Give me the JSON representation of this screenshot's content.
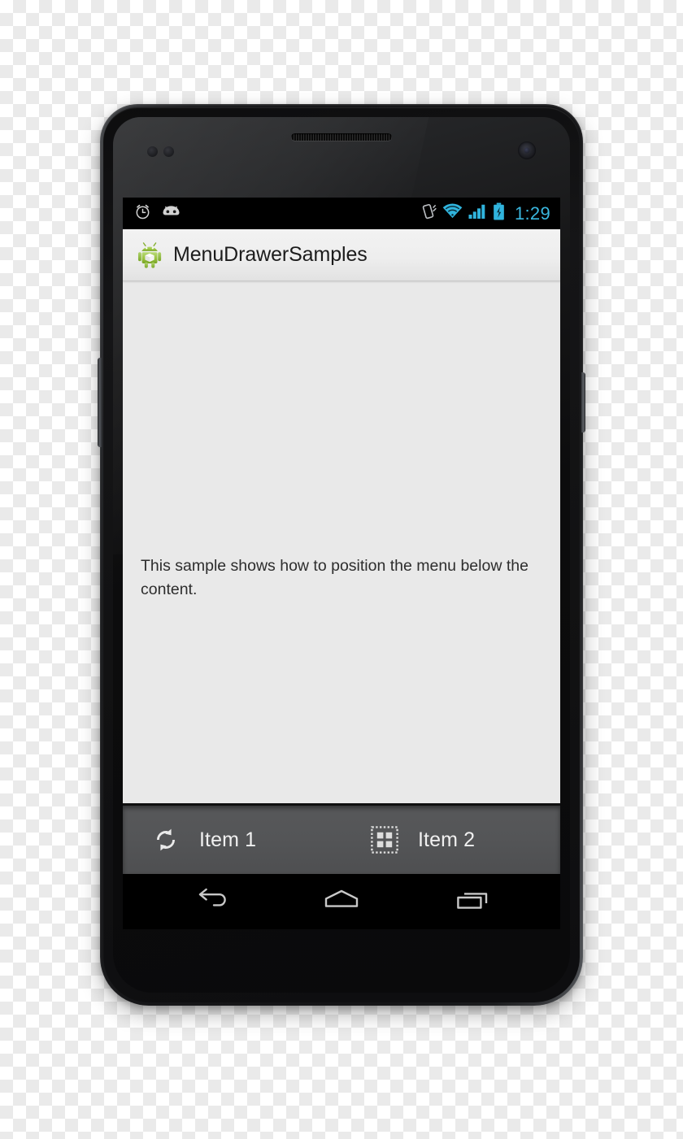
{
  "device": {
    "name": "android-phone",
    "hardware": {
      "earpiece": "earpiece-speaker",
      "front_camera": "front-camera",
      "proximity_sensor": "proximity-sensor",
      "light_sensor": "light-sensor",
      "power_button": "power-button",
      "volume_button": "volume-button"
    }
  },
  "status_bar": {
    "clock": "1:29",
    "clock_color": "#3ab8e0",
    "background": "#000000",
    "left_icons": [
      {
        "name": "alarm-clock-icon",
        "label": "Alarm set"
      },
      {
        "name": "android-jellybean-icon",
        "label": "Android system"
      }
    ],
    "right_icons": [
      {
        "name": "vibrate-icon",
        "label": "Ringer vibrate"
      },
      {
        "name": "wifi-icon",
        "label": "Wi-Fi connected"
      },
      {
        "name": "cellular-signal-icon",
        "label": "Cellular signal"
      },
      {
        "name": "battery-charging-icon",
        "label": "Battery charging"
      }
    ]
  },
  "action_bar": {
    "app_icon": "android-robot-app-icon",
    "title": "MenuDrawerSamples",
    "background": "#eeeeee",
    "title_color": "#1c1c1c"
  },
  "content": {
    "background": "#e9e9e9",
    "text": "This sample shows how to position the menu below the content."
  },
  "menu_bar": {
    "background": "#545557",
    "items": [
      {
        "icon": "refresh-icon",
        "label": "Item 1"
      },
      {
        "icon": "gallery-grid-icon",
        "label": "Item 2"
      }
    ]
  },
  "nav_bar": {
    "background": "#000000",
    "buttons": [
      {
        "icon": "back-icon",
        "label": "Back"
      },
      {
        "icon": "home-icon",
        "label": "Home"
      },
      {
        "icon": "recents-icon",
        "label": "Recent apps"
      }
    ]
  }
}
